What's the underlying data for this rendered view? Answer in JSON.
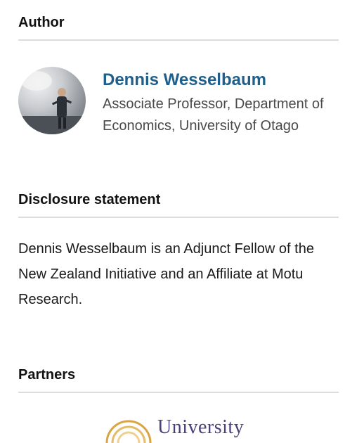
{
  "author_section": {
    "heading": "Author",
    "author": {
      "name": "Dennis Wesselbaum",
      "role": "Associate Professor, Department of Economics, University of Otago"
    }
  },
  "disclosure_section": {
    "heading": "Disclosure statement",
    "text": "Dennis Wesselbaum is an Adjunct Fellow of the New Zealand Initiative and an Affiliate at Motu Research."
  },
  "partners_section": {
    "heading": "Partners",
    "logo_text": "University"
  },
  "colors": {
    "link": "#1f5f8b",
    "divider": "#dcdcdc",
    "logo_text": "#4a3f7a",
    "logo_arc": "#d9a441"
  }
}
